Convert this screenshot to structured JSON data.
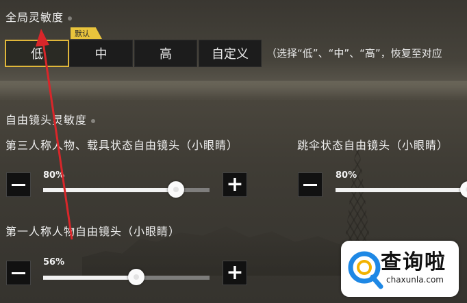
{
  "global": {
    "title": "全局灵敏度",
    "options": [
      "低",
      "中",
      "高",
      "自定义"
    ],
    "selected": "低",
    "default_badge": "默认",
    "hint": "（选择“低”、“中”、“高”，恢复至对应"
  },
  "freelook": {
    "title": "自由镜头灵敏度",
    "sliders": [
      {
        "label": "第三人称人物、载具状态自由镜头（小眼睛）",
        "percent_text": "80%",
        "value": 0.8
      },
      {
        "label": "跳伞状态自由镜头（小眼睛）",
        "percent_text": "80%",
        "value": 0.8
      },
      {
        "label": "第一人称人物自由镜头（小眼睛）",
        "percent_text": "56%",
        "value": 0.56
      }
    ]
  },
  "watermark": {
    "cn": "查询啦",
    "en": "chaxunla.com"
  },
  "colors": {
    "accent": "#e0b73a",
    "badge": "#e9c43c",
    "arrow": "#d9262a",
    "watermark_blue": "#1e88e5"
  }
}
